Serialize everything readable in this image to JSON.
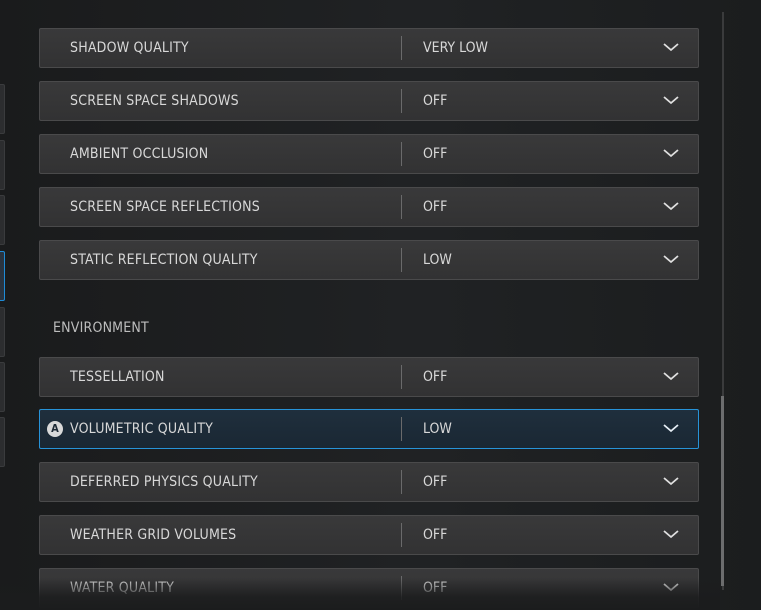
{
  "section": {
    "environment_heading": "ENVIRONMENT"
  },
  "settings": {
    "shadow_quality": {
      "label": "SHADOW QUALITY",
      "value": "VERY LOW"
    },
    "screen_space_shadows": {
      "label": "SCREEN SPACE SHADOWS",
      "value": "OFF"
    },
    "ambient_occlusion": {
      "label": "AMBIENT OCCLUSION",
      "value": "OFF"
    },
    "screen_space_reflections": {
      "label": "SCREEN SPACE REFLECTIONS",
      "value": "OFF"
    },
    "static_reflection_quality": {
      "label": "STATIC REFLECTION QUALITY",
      "value": "LOW"
    },
    "tessellation": {
      "label": "TESSELLATION",
      "value": "OFF"
    },
    "volumetric_quality": {
      "label": "VOLUMETRIC QUALITY",
      "value": "LOW",
      "selected": true,
      "button_prompt": "A"
    },
    "deferred_physics_quality": {
      "label": "DEFERRED PHYSICS QUALITY",
      "value": "OFF"
    },
    "weather_grid_volumes": {
      "label": "WEATHER GRID VOLUMES",
      "value": "OFF"
    },
    "water_quality": {
      "label": "WATER QUALITY",
      "value": "OFF"
    }
  },
  "icons": {
    "dropdown": "chevron-down-icon",
    "prompt": "a-button-icon"
  },
  "colors": {
    "selection_accent": "#2793d8",
    "row_background": "#363637",
    "page_background": "#1b1c1d"
  }
}
